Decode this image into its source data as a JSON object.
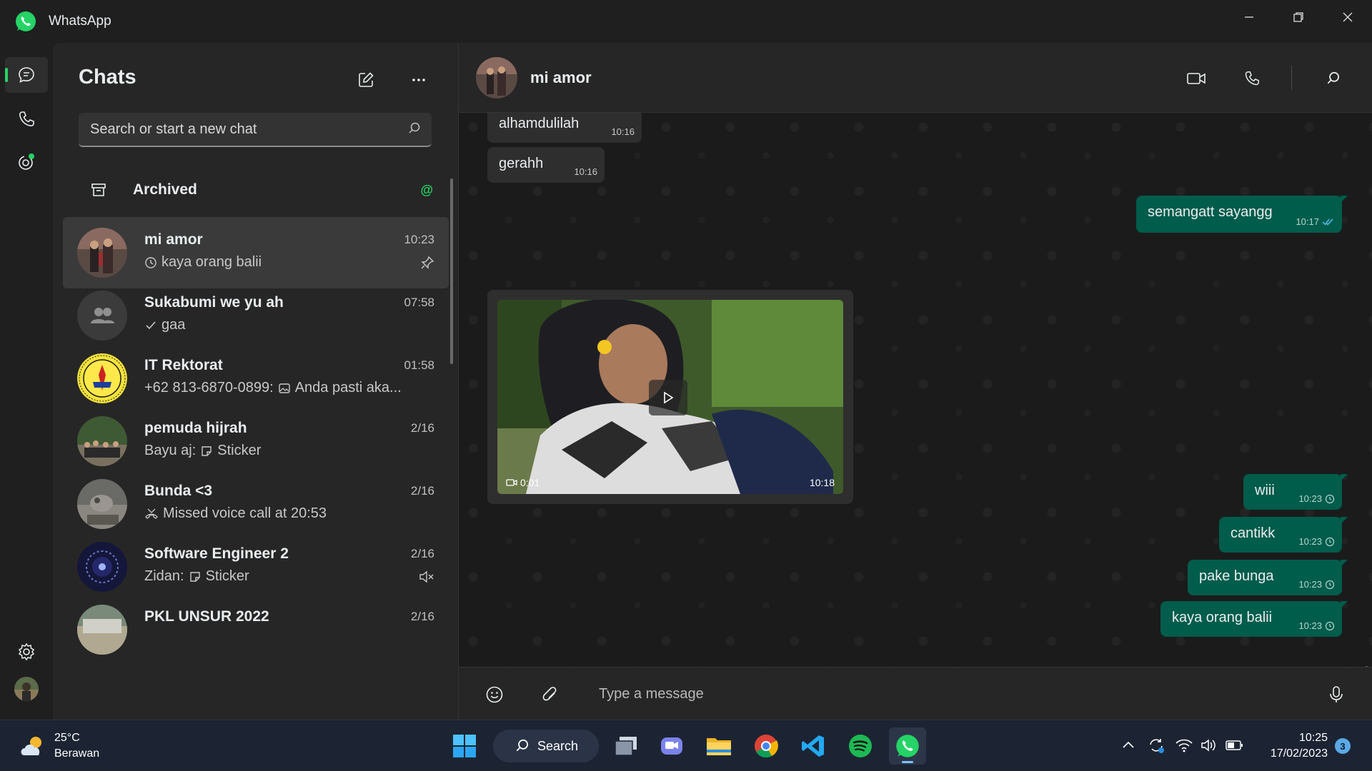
{
  "app": {
    "title": "WhatsApp"
  },
  "chatlist": {
    "title": "Chats",
    "search_placeholder": "Search or start a new chat",
    "archived_label": "Archived",
    "archived_mention": "@",
    "items": [
      {
        "name": "mi amor",
        "time": "10:23",
        "preview": "kaya orang balii",
        "status_icon": "clock-icon",
        "badge_icon": "pin-icon"
      },
      {
        "name": "Sukabumi we yu ah",
        "time": "07:58",
        "preview": "gaa",
        "status_icon": "check-icon"
      },
      {
        "name": "IT Rektorat",
        "time": "01:58",
        "preview_sender": "+62 813-6870-0899:",
        "preview": "Anda pasti aka...",
        "status_icon": "image-icon"
      },
      {
        "name": "pemuda hijrah",
        "time": "2/16",
        "preview_sender": "Bayu aj:",
        "preview": "Sticker",
        "status_icon": "sticker-icon"
      },
      {
        "name": "Bunda <3",
        "time": "2/16",
        "preview": "Missed voice call at 20:53",
        "status_icon": "missed-call-icon"
      },
      {
        "name": "Software Engineer 2",
        "time": "2/16",
        "preview_sender": "Zidan:",
        "preview": "Sticker",
        "status_icon": "sticker-icon",
        "badge_icon": "mute-icon"
      },
      {
        "name": "PKL UNSUR 2022",
        "time": "2/16"
      }
    ]
  },
  "conversation": {
    "name": "mi amor",
    "messages": [
      {
        "dir": "in",
        "text": "alhamdulilah",
        "time": "10:16"
      },
      {
        "dir": "in",
        "text": "gerahh",
        "time": "10:16"
      },
      {
        "dir": "out",
        "text": "semangatt sayangg",
        "time": "10:17",
        "status": "read"
      },
      {
        "dir": "in",
        "type": "video",
        "duration": "0:01",
        "time": "10:18"
      },
      {
        "dir": "out",
        "text": "wiii",
        "time": "10:23",
        "status": "pending"
      },
      {
        "dir": "out",
        "text": "cantikk",
        "time": "10:23",
        "status": "pending"
      },
      {
        "dir": "out",
        "text": "pake bunga",
        "time": "10:23",
        "status": "pending"
      },
      {
        "dir": "out",
        "text": "kaya orang balii",
        "time": "10:23",
        "status": "pending"
      }
    ],
    "composer_placeholder": "Type a message"
  },
  "taskbar": {
    "weather_temp": "25°C",
    "weather_desc": "Berawan",
    "search_label": "Search",
    "time": "10:25",
    "date": "17/02/2023",
    "notifications": "3"
  },
  "colors": {
    "accent": "#25d366",
    "outgoing_bubble": "#005c4b",
    "incoming_bubble": "#2e2e2e",
    "panel": "#262626",
    "taskbar": "#1c2433"
  }
}
